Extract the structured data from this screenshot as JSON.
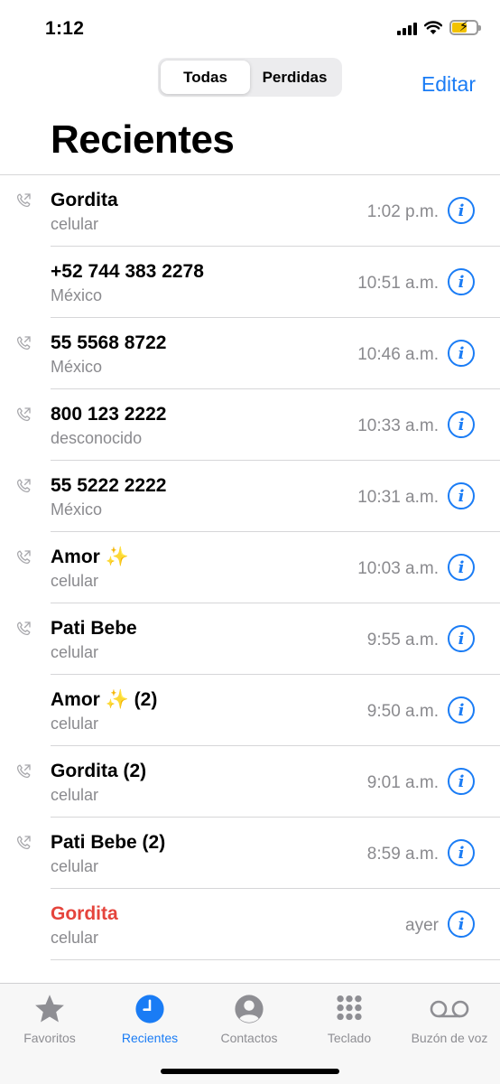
{
  "status_bar": {
    "time": "1:12"
  },
  "header": {
    "segments": [
      "Todas",
      "Perdidas"
    ],
    "active_segment": "Todas",
    "edit_label": "Editar",
    "title": "Recientes"
  },
  "calls": [
    {
      "name": "Gordita",
      "sub": "celular",
      "time": "1:02 p.m.",
      "outgoing": true,
      "missed": false
    },
    {
      "name": "+52 744 383 2278",
      "sub": "México",
      "time": "10:51 a.m.",
      "outgoing": false,
      "missed": false
    },
    {
      "name": "55 5568 8722",
      "sub": "México",
      "time": "10:46 a.m.",
      "outgoing": true,
      "missed": false
    },
    {
      "name": "800 123 2222",
      "sub": "desconocido",
      "time": "10:33 a.m.",
      "outgoing": true,
      "missed": false
    },
    {
      "name": "55 5222 2222",
      "sub": "México",
      "time": "10:31 a.m.",
      "outgoing": true,
      "missed": false
    },
    {
      "name": "Amor ✨",
      "sub": "celular",
      "time": "10:03 a.m.",
      "outgoing": true,
      "missed": false
    },
    {
      "name": "Pati Bebe",
      "sub": "celular",
      "time": "9:55 a.m.",
      "outgoing": true,
      "missed": false
    },
    {
      "name": "Amor ✨ (2)",
      "sub": "celular",
      "time": "9:50 a.m.",
      "outgoing": false,
      "missed": false
    },
    {
      "name": "Gordita  (2)",
      "sub": "celular",
      "time": "9:01 a.m.",
      "outgoing": true,
      "missed": false
    },
    {
      "name": "Pati Bebe  (2)",
      "sub": "celular",
      "time": "8:59 a.m.",
      "outgoing": true,
      "missed": false
    },
    {
      "name": "Gordita",
      "sub": "celular",
      "time": "ayer",
      "outgoing": false,
      "missed": true
    }
  ],
  "tab_bar": {
    "tabs": [
      {
        "label": "Favoritos",
        "icon": "star-icon"
      },
      {
        "label": "Recientes",
        "icon": "clock-icon"
      },
      {
        "label": "Contactos",
        "icon": "person-circle-icon"
      },
      {
        "label": "Teclado",
        "icon": "keypad-icon"
      },
      {
        "label": "Buzón de voz",
        "icon": "voicemail-icon"
      }
    ],
    "active_tab": "Recientes"
  },
  "colors": {
    "accent": "#1a7cf5",
    "missed": "#e5443c",
    "secondary_text": "#8a8a8e",
    "battery": "#f2c200"
  }
}
